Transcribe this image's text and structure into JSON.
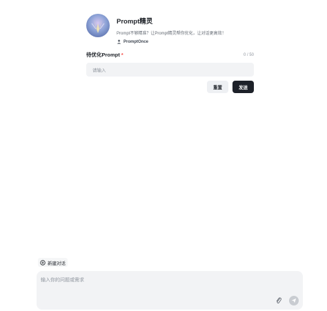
{
  "agent": {
    "title": "Prompt精灵",
    "description": "Prompt不够精准？让Prompt精灵帮你优化，让对话更高效！",
    "author": "PromptOnce",
    "avatar_icon": "agent-avatar-icon"
  },
  "form": {
    "field_label": "待优化Prompt",
    "required_mark": "*",
    "counter": "0 / 50",
    "input_placeholder": "请输入",
    "reset_label": "重置",
    "send_label": "发送"
  },
  "chat": {
    "new_chat_label": "新建对话",
    "composer_placeholder": "输入你的问题或需求"
  },
  "colors": {
    "send_button": "#1d2129",
    "input_bg": "#f2f3f5",
    "required": "#f54a45"
  }
}
